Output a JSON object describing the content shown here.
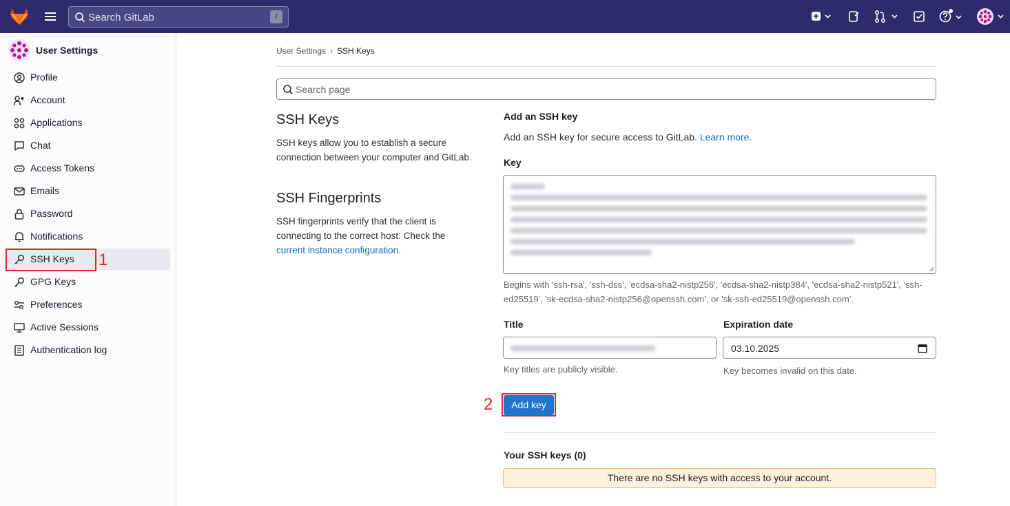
{
  "topbar": {
    "search_placeholder": "Search GitLab",
    "search_shortcut": "/",
    "icons": [
      "gitlab-logo",
      "hamburger-icon",
      "search-icon",
      "new-item-icon",
      "issues-icon",
      "merge-request-icon",
      "todo-icon",
      "help-icon",
      "user-avatar"
    ]
  },
  "sidebar": {
    "title": "User Settings",
    "items": [
      {
        "label": "Profile",
        "icon": "profile-icon"
      },
      {
        "label": "Account",
        "icon": "account-icon"
      },
      {
        "label": "Applications",
        "icon": "applications-icon"
      },
      {
        "label": "Chat",
        "icon": "chat-icon"
      },
      {
        "label": "Access Tokens",
        "icon": "token-icon"
      },
      {
        "label": "Emails",
        "icon": "mail-icon"
      },
      {
        "label": "Password",
        "icon": "lock-icon"
      },
      {
        "label": "Notifications",
        "icon": "bell-icon"
      },
      {
        "label": "SSH Keys",
        "icon": "key-icon",
        "active": true
      },
      {
        "label": "GPG Keys",
        "icon": "key-icon"
      },
      {
        "label": "Preferences",
        "icon": "preferences-icon"
      },
      {
        "label": "Active Sessions",
        "icon": "monitor-icon"
      },
      {
        "label": "Authentication log",
        "icon": "log-icon"
      }
    ]
  },
  "annotations": {
    "one": "1",
    "two": "2"
  },
  "breadcrumb": {
    "parent": "User Settings",
    "current": "SSH Keys"
  },
  "page_search": {
    "placeholder": "Search page"
  },
  "ssh_keys_section": {
    "title": "SSH Keys",
    "description": "SSH keys allow you to establish a secure connection between your computer and GitLab."
  },
  "fingerprints_section": {
    "title": "SSH Fingerprints",
    "description": "SSH fingerprints verify that the client is connecting to the correct host. Check the",
    "link": "current instance configuration",
    "trailing": "."
  },
  "add_key": {
    "heading": "Add an SSH key",
    "intro": "Add an SSH key for secure access to GitLab.",
    "learn_more": "Learn more.",
    "key_label": "Key",
    "key_help": "Begins with 'ssh-rsa', 'ssh-dss', 'ecdsa-sha2-nistp256', 'ecdsa-sha2-nistp384', 'ecdsa-sha2-nistp521', 'ssh-ed25519', 'sk-ecdsa-sha2-nistp256@openssh.com', or 'sk-ssh-ed25519@openssh.com'.",
    "title_label": "Title",
    "title_help": "Key titles are publicly visible.",
    "expiration_label": "Expiration date",
    "expiration_value": "03.10.2025",
    "expiration_help": "Key becomes invalid on this date.",
    "submit": "Add key"
  },
  "your_keys": {
    "heading": "Your SSH keys (0)",
    "empty": "There are no SSH keys with access to your account."
  }
}
